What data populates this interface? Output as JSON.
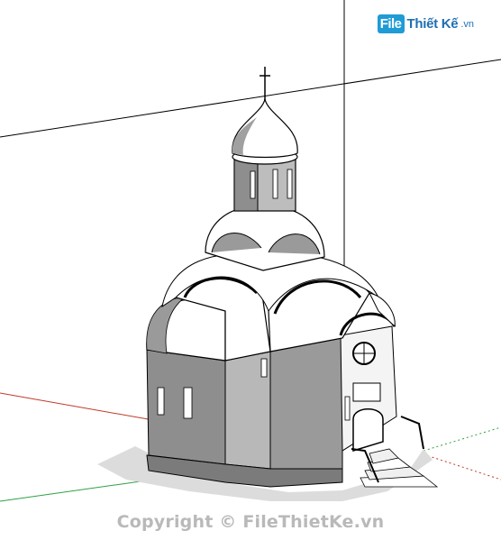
{
  "watermark": {
    "logo_badge": "File",
    "logo_name": "Thiết Kế",
    "logo_tld": ".vn",
    "copyright": "Copyright © FileThietKe.vn"
  },
  "model": {
    "subject": "church-chapel-3d-model",
    "axis_colors": {
      "red_axis": "#c0392b",
      "green_axis": "#2ea043",
      "blue_axis": "#1f3fbf"
    },
    "wall_color": "#9a9a9a",
    "dome_color": "#ffffff",
    "shadow_color": "#d8d8d8",
    "line_color": "#000000"
  }
}
